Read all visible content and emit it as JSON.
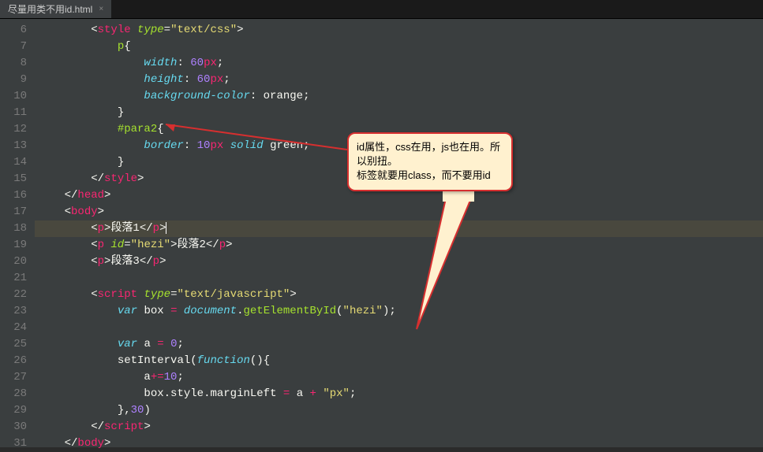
{
  "tab": {
    "title": "尽量用类不用id.html",
    "close": "×"
  },
  "gutter": [
    "6",
    "7",
    "8",
    "9",
    "10",
    "11",
    "12",
    "13",
    "14",
    "15",
    "16",
    "17",
    "18",
    "19",
    "20",
    "21",
    "22",
    "23",
    "24",
    "25",
    "26",
    "27",
    "28",
    "29",
    "30",
    "31"
  ],
  "callout": {
    "l1": "id属性，css在用，js也在用。所以别扭。",
    "l2": "标签就要用class，而不要用id"
  },
  "code": {
    "l6": {
      "indent": "        ",
      "open": "<",
      "tag": "style",
      "sp": " ",
      "attr": "type",
      "eq": "=",
      "q1": "\"",
      "val": "text/css",
      "q2": "\"",
      "close": ">"
    },
    "l7": {
      "indent": "            ",
      "sel": "p",
      "brace": "{"
    },
    "l8": {
      "indent": "                ",
      "prop": "width",
      "colon": ": ",
      "num": "60",
      "unit": "px",
      "semi": ";"
    },
    "l9": {
      "indent": "                ",
      "prop": "height",
      "colon": ": ",
      "num": "60",
      "unit": "px",
      "semi": ";"
    },
    "l10": {
      "indent": "                ",
      "prop": "background-color",
      "colon": ": ",
      "val": "orange",
      "semi": ";"
    },
    "l11": {
      "indent": "            ",
      "brace": "}"
    },
    "l12": {
      "indent": "            ",
      "sel": "#para2",
      "brace": "{"
    },
    "l13": {
      "indent": "                ",
      "prop": "border",
      "colon": ": ",
      "num": "10",
      "unit": "px",
      "sp": " ",
      "val1": "solid",
      "sp2": " ",
      "val2": "green",
      "semi": ";"
    },
    "l14": {
      "indent": "            ",
      "brace": "}"
    },
    "l15": {
      "indent": "        ",
      "open": "</",
      "tag": "style",
      "close": ">"
    },
    "l16": {
      "indent": "    ",
      "open": "</",
      "tag": "head",
      "close": ">"
    },
    "l17": {
      "indent": "    ",
      "open": "<",
      "tag": "body",
      "close": ">"
    },
    "l18": {
      "indent": "        ",
      "open1": "<",
      "tag1": "p",
      "close1": ">",
      "text": "段落1",
      "open2": "</",
      "tag2": "p",
      "close2": ">"
    },
    "l19": {
      "indent": "        ",
      "open1": "<",
      "tag1": "p",
      "sp": " ",
      "attr": "id",
      "eq": "=",
      "q1": "\"",
      "val": "hezi",
      "q2": "\"",
      "close1": ">",
      "text": "段落2",
      "open2": "</",
      "tag2": "p",
      "close2": ">"
    },
    "l20": {
      "indent": "        ",
      "open1": "<",
      "tag1": "p",
      "close1": ">",
      "text": "段落3",
      "open2": "</",
      "tag2": "p",
      "close2": ">"
    },
    "l22": {
      "indent": "        ",
      "open": "<",
      "tag": "script",
      "sp": " ",
      "attr": "type",
      "eq": "=",
      "q1": "\"",
      "val": "text/javascript",
      "q2": "\"",
      "close": ">"
    },
    "l23": {
      "indent": "            ",
      "kw": "var",
      "sp": " ",
      "name": "box ",
      "eq": "= ",
      "obj": "document",
      "dot": ".",
      "fn": "getElementById",
      "p1": "(",
      "q1": "\"",
      "arg": "hezi",
      "q2": "\"",
      "p2": ")",
      "semi": ";"
    },
    "l25": {
      "indent": "            ",
      "kw": "var",
      "sp": " ",
      "name": "a ",
      "eq": "= ",
      "num": "0",
      "semi": ";"
    },
    "l26": {
      "indent": "            ",
      "fn": "setInterval",
      "p1": "(",
      "kw": "function",
      "p2": "()",
      "brace": "{"
    },
    "l27": {
      "indent": "                ",
      "name": "a",
      "op": "+=",
      "num": "10",
      "semi": ";"
    },
    "l28": {
      "indent": "                ",
      "name": "box",
      "dot1": ".",
      "prop1": "style",
      "dot2": ".",
      "prop2": "marginLeft ",
      "eq": "= ",
      "var": "a ",
      "op": "+ ",
      "q1": "\"",
      "str": "px",
      "q2": "\"",
      "semi": ";"
    },
    "l29": {
      "indent": "            ",
      "brace": "}",
      "comma": ",",
      "num": "30",
      "p": ")"
    },
    "l30": {
      "indent": "        ",
      "open": "</",
      "tag": "script",
      "close": ">"
    },
    "l31": {
      "indent": "    ",
      "open": "</",
      "tag": "body",
      "close": ">"
    }
  }
}
